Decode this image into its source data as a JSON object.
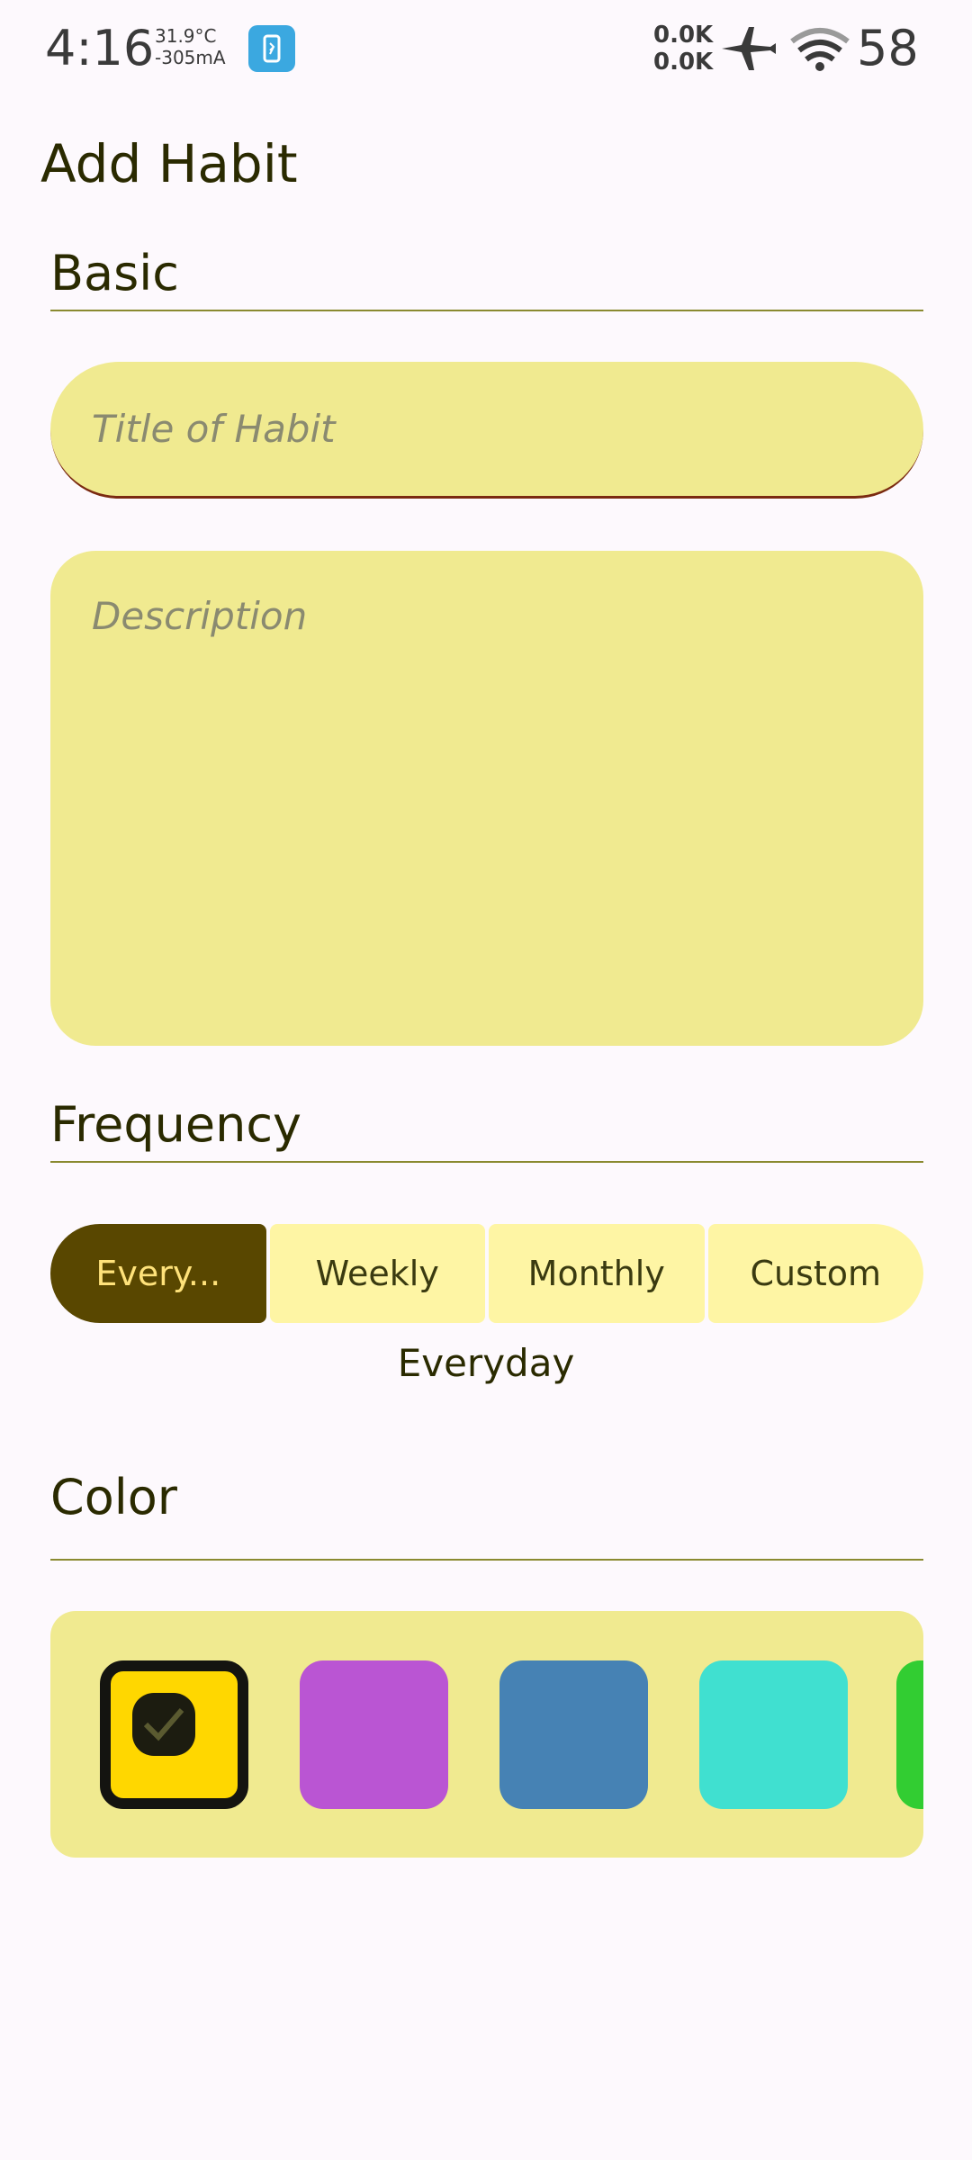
{
  "status_bar": {
    "time": "4:16",
    "temperature": "31.9°C",
    "current": "-305mA",
    "net_up": "0.0K",
    "net_down": "0.0K",
    "battery": "58"
  },
  "page": {
    "title": "Add Habit"
  },
  "basic": {
    "section_title": "Basic",
    "title_placeholder": "Title of Habit",
    "description_placeholder": "Description"
  },
  "frequency": {
    "section_title": "Frequency",
    "options": [
      "Every...",
      "Weekly",
      "Monthly",
      "Custom"
    ],
    "selected_index": 0,
    "selected_label": "Everyday"
  },
  "color": {
    "section_title": "Color",
    "swatches": [
      "#FFD700",
      "#BA55D3",
      "#4682B4",
      "#40E0D0",
      "#32CD32"
    ],
    "selected_index": 0
  },
  "colors": {
    "accent": "#594700",
    "field_bg": "#F0EA90",
    "segment_bg": "#FEF5A4",
    "background": "#FDF9FD"
  },
  "icons": {
    "airplane": "airplane-icon",
    "wifi": "wifi-icon",
    "check": "check-icon"
  }
}
